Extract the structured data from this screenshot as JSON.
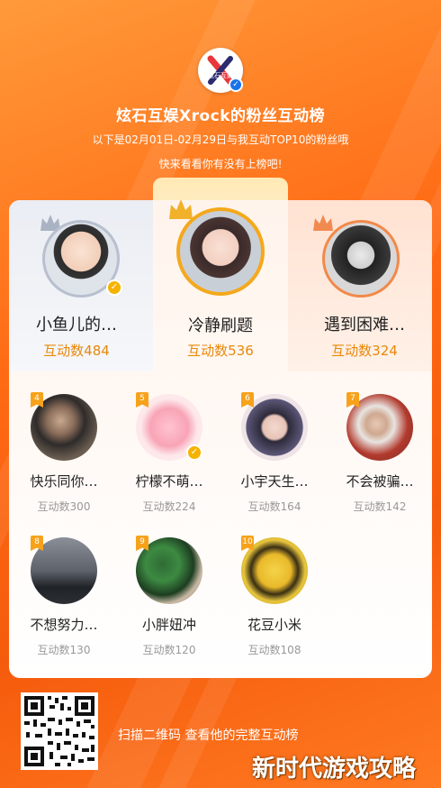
{
  "header": {
    "title": "炫石互娱Xrock的粉丝互动榜",
    "subtitle_line1": "以下是02月01日-02月29日与我互动TOP10的粉丝哦",
    "subtitle_line2": "快来看看你有没有上榜吧!",
    "logo_text": "炫石互娱"
  },
  "top3": [
    {
      "rank": 2,
      "name": "小鱼儿的…",
      "count": "互动数484",
      "crown": "silver-crown-icon"
    },
    {
      "rank": 1,
      "name": "冷静刷题",
      "count": "互动数536",
      "crown": "gold-crown-icon"
    },
    {
      "rank": 3,
      "name": "遇到困难…",
      "count": "互动数324",
      "crown": "bronze-crown-icon"
    }
  ],
  "fans": [
    {
      "rank": "4",
      "name": "快乐同你…",
      "count": "互动数300"
    },
    {
      "rank": "5",
      "name": "柠檬不萌…",
      "count": "互动数224"
    },
    {
      "rank": "6",
      "name": "小宇天生…",
      "count": "互动数164"
    },
    {
      "rank": "7",
      "name": "不会被骗…",
      "count": "互动数142"
    },
    {
      "rank": "8",
      "name": "不想努力…",
      "count": "互动数130"
    },
    {
      "rank": "9",
      "name": "小胖妞冲",
      "count": "互动数120"
    },
    {
      "rank": "10",
      "name": "花豆小米",
      "count": "互动数108"
    }
  ],
  "footer": {
    "scan_text": "扫描二维码 查看他的完整互动榜",
    "watermark": "新时代游戏攻略"
  },
  "colors": {
    "accent": "#f55b0c",
    "count_highlight": "#e8880a",
    "rank_badge": "#f7a21b",
    "verify": "#f5b300"
  }
}
